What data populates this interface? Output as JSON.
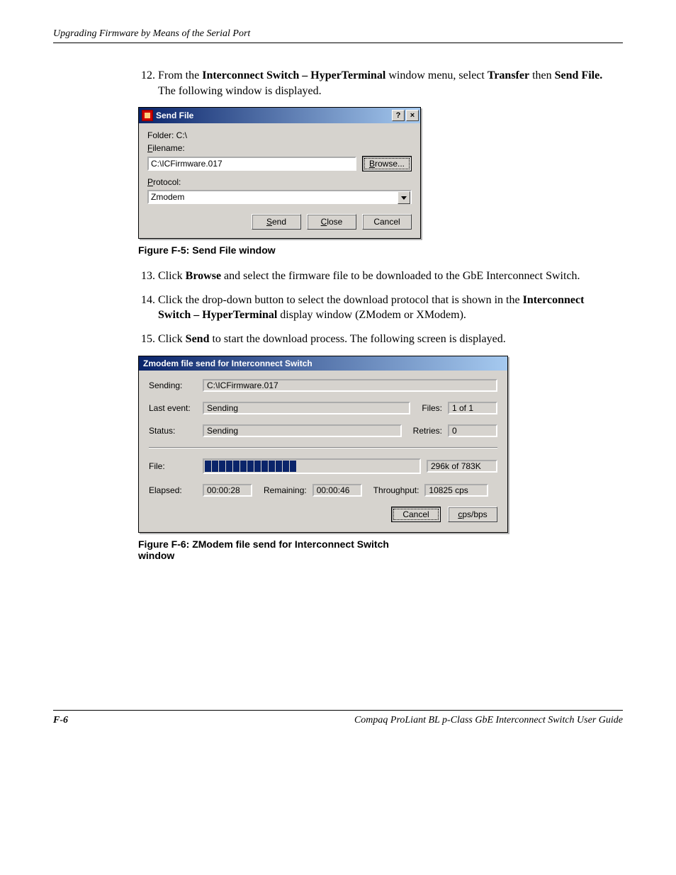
{
  "header": "Upgrading Firmware by Means of the Serial Port",
  "steps": {
    "s12_a": "From the ",
    "s12_b": "Interconnect Switch – HyperTerminal",
    "s12_c": " window menu, select ",
    "s12_d": "Transfer",
    "s12_e": " then ",
    "s12_f": "Send File.",
    "s12_g": " The following window is displayed.",
    "s13_a": "Click ",
    "s13_b": "Browse",
    "s13_c": " and select the firmware file to be downloaded to the GbE Interconnect Switch.",
    "s14_a": "Click the drop-down button to select the download protocol that is shown in the ",
    "s14_b": "Interconnect Switch – HyperTerminal",
    "s14_c": " display window (ZModem or XModem).",
    "s15_a": "Click ",
    "s15_b": "Send",
    "s15_c": " to start the download process. The following screen is displayed."
  },
  "fig5": "Figure F-5:  Send File window",
  "fig6": "Figure F-6:  ZModem file send for Interconnect Switch window",
  "sendfile": {
    "title": "Send File",
    "help": "?",
    "close_x": "×",
    "folder_label": "Folder: C:\\",
    "filename_label_pre": "F",
    "filename_label_post": "ilename:",
    "filename_value": "C:\\ICFirmware.017",
    "browse_pre": "B",
    "browse_post": "rowse...",
    "protocol_label_pre": "P",
    "protocol_label_post": "rotocol:",
    "protocol_value": "Zmodem",
    "send_pre": "S",
    "send_post": "end",
    "close_pre": "C",
    "close_post": "lose",
    "cancel": "Cancel"
  },
  "zmodem": {
    "title": "Zmodem file send for Interconnect Switch",
    "sending_label": "Sending:",
    "sending_value": "C:\\ICFirmware.017",
    "lastevent_label": "Last event:",
    "lastevent_value": "Sending",
    "files_label": "Files:",
    "files_value": "1 of 1",
    "status_label": "Status:",
    "status_value": "Sending",
    "retries_label": "Retries:",
    "retries_value": "0",
    "file_label": "File:",
    "file_progress_text": "296k of 783K",
    "elapsed_label": "Elapsed:",
    "elapsed_value": "00:00:28",
    "remaining_label": "Remaining:",
    "remaining_value": "00:00:46",
    "throughput_label": "Throughput:",
    "throughput_value": "10825 cps",
    "cancel": "Cancel",
    "cpsbps_pre": "c",
    "cpsbps_post": "ps/bps"
  },
  "footer": {
    "page": "F-6",
    "guide": "Compaq ProLiant BL p-Class GbE Interconnect Switch User Guide"
  }
}
